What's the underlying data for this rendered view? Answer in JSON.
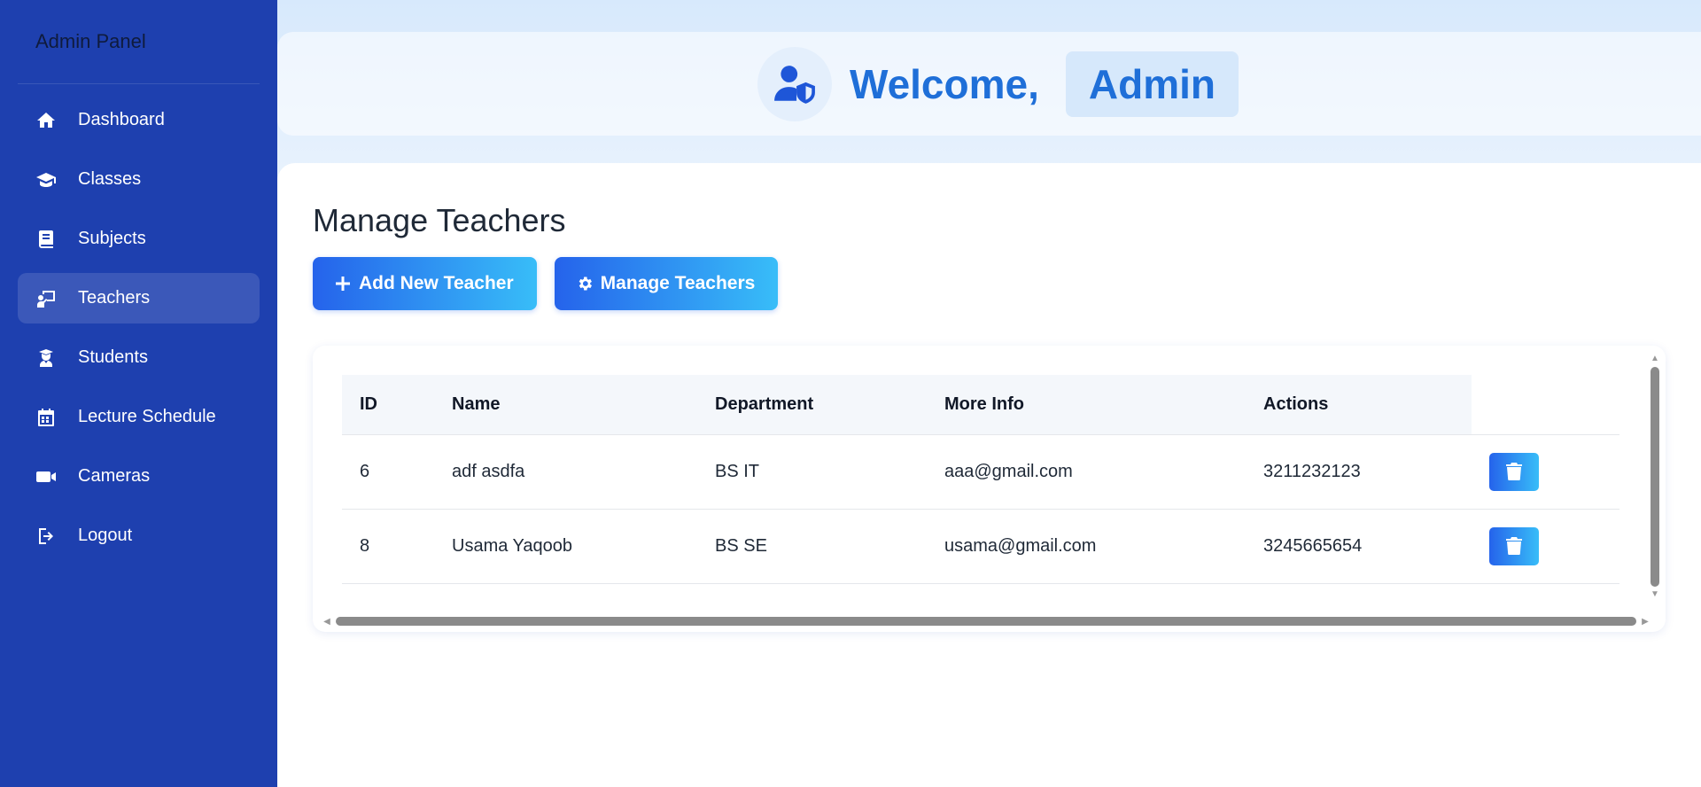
{
  "sidebar": {
    "brand": "Admin Panel",
    "items": [
      {
        "label": "Dashboard",
        "icon": "home-icon"
      },
      {
        "label": "Classes",
        "icon": "graduation-cap-icon"
      },
      {
        "label": "Subjects",
        "icon": "book-icon"
      },
      {
        "label": "Teachers",
        "icon": "chalkboard-teacher-icon",
        "active": true
      },
      {
        "label": "Students",
        "icon": "user-graduate-icon"
      },
      {
        "label": "Lecture Schedule",
        "icon": "calendar-icon"
      },
      {
        "label": "Cameras",
        "icon": "video-camera-icon"
      },
      {
        "label": "Logout",
        "icon": "logout-icon"
      }
    ]
  },
  "header": {
    "welcome": "Welcome,",
    "user": "Admin",
    "icon": "user-shield-icon"
  },
  "main": {
    "title": "Manage Teachers",
    "buttons": {
      "add": "Add New Teacher",
      "manage": "Manage Teachers"
    },
    "table": {
      "columns": [
        "ID",
        "Name",
        "Department",
        "More Info",
        "Actions"
      ],
      "rows": [
        {
          "id": "6",
          "name": "adf asdfa",
          "department": "BS IT",
          "email": "aaa@gmail.com",
          "phone": "3211232123"
        },
        {
          "id": "8",
          "name": "Usama Yaqoob",
          "department": "BS SE",
          "email": "usama@gmail.com",
          "phone": "3245665654"
        }
      ]
    }
  },
  "colors": {
    "sidebar_bg": "#1e40af",
    "accent_start": "#2563eb",
    "accent_end": "#38bdf8",
    "welcome_text": "#1f6fd8"
  }
}
